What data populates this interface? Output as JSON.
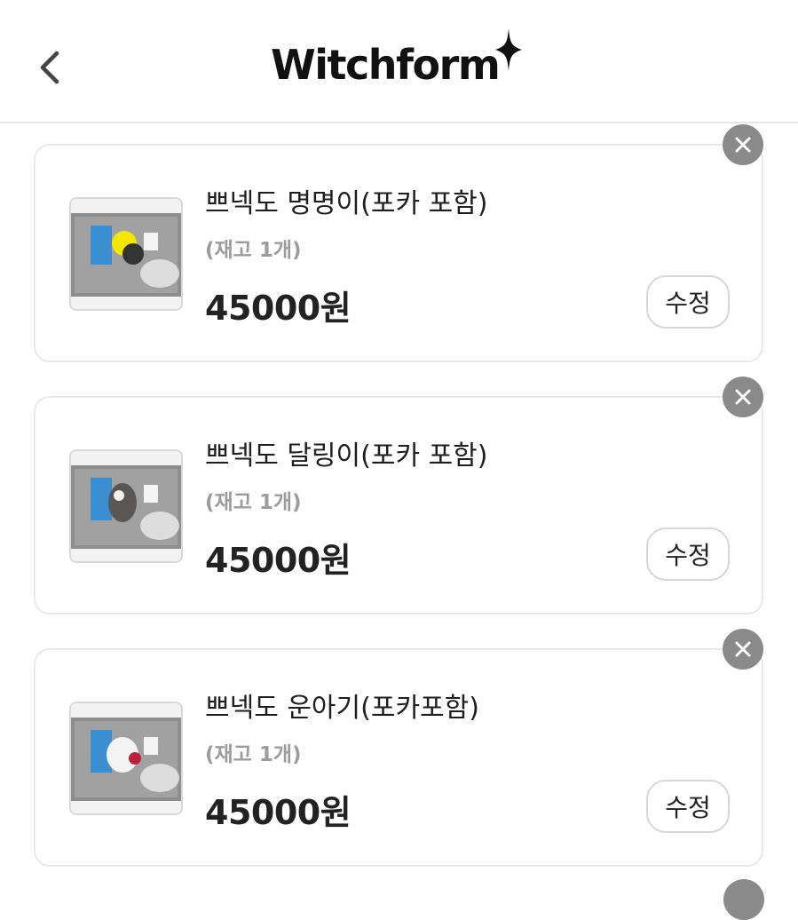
{
  "header": {
    "logo_text": "Witchform",
    "back_icon": "chevron-left-icon",
    "logo_icon": "sparkle-star-icon"
  },
  "colors": {
    "remove_button_bg": "#8a8a8a",
    "stock_text": "#9c9c9c",
    "card_border": "#e9e9e9"
  },
  "items": [
    {
      "title": "쁘넥도 명명이(포카 포함)",
      "stock": "(재고 1개)",
      "price": "45000원",
      "edit_label": "수정",
      "remove_icon": "close-icon",
      "thumb_accent": "#f3e600"
    },
    {
      "title": "쁘넥도 달링이(포카 포함)",
      "stock": "(재고 1개)",
      "price": "45000원",
      "edit_label": "수정",
      "remove_icon": "close-icon",
      "thumb_accent": "#5a5654"
    },
    {
      "title": "쁘넥도 운아기(포카포함)",
      "stock": "(재고 1개)",
      "price": "45000원",
      "edit_label": "수정",
      "remove_icon": "close-icon",
      "thumb_accent": "#c0213a"
    }
  ]
}
